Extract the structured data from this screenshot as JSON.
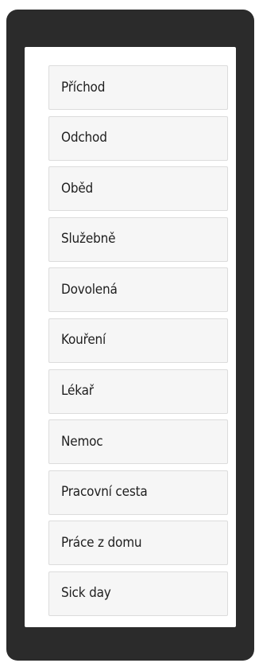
{
  "menu": {
    "items": [
      {
        "label": "Příchod"
      },
      {
        "label": "Odchod"
      },
      {
        "label": "Oběd"
      },
      {
        "label": "Služebně"
      },
      {
        "label": "Dovolená"
      },
      {
        "label": "Kouření"
      },
      {
        "label": "Lékař"
      },
      {
        "label": "Nemoc"
      },
      {
        "label": "Pracovní cesta"
      },
      {
        "label": "Práce z domu"
      },
      {
        "label": "Sick day"
      }
    ]
  },
  "colors": {
    "frame": "#2b2b2b",
    "panel": "#ffffff",
    "button_bg": "#f6f6f6",
    "button_border": "#dcdcdc",
    "text": "#1f1f1f"
  }
}
